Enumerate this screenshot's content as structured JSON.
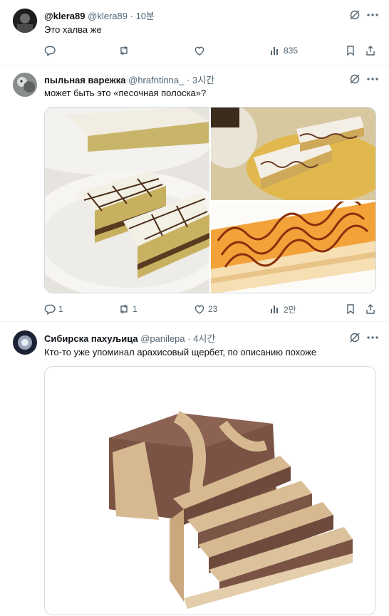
{
  "tweets": [
    {
      "name": "@klera89",
      "handle": "@klera89",
      "separator": "·",
      "time": "10분",
      "text": "Это халва же",
      "replies": "",
      "retweets": "",
      "likes": "",
      "views": "835"
    },
    {
      "name": "пыльная варежка",
      "handle": "@hrafntinna_",
      "separator": "·",
      "time": "3시간",
      "text": "может быть это «песочная полоска»?",
      "replies": "1",
      "retweets": "1",
      "likes": "23",
      "views": "2만"
    },
    {
      "name": "Сибирска пахуљица",
      "handle": "@panilepa",
      "separator": "·",
      "time": "4시간",
      "text": "Кто-то уже упоминал арахисовый щербет, по описанию похоже"
    }
  ],
  "icons": {
    "grok": "grok-icon",
    "more": "more-icon",
    "reply": "reply-icon",
    "retweet": "retweet-icon",
    "like": "heart-icon",
    "views": "views-icon",
    "bookmark": "bookmark-icon",
    "share": "share-icon"
  },
  "colors": {
    "text": "#0f1419",
    "secondary": "#536471",
    "border": "#eff3f4"
  }
}
